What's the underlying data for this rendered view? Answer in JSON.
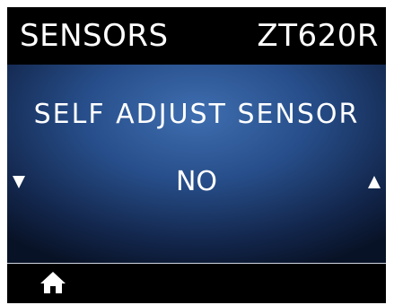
{
  "header": {
    "menu_title": "SENSORS",
    "printer_model": "ZT620R"
  },
  "setting": {
    "name": "SELF ADJUST SENSOR",
    "value": "NO"
  },
  "controls": {
    "prev_icon": "triangle-down-icon",
    "next_icon": "triangle-up-icon",
    "home_icon": "home-icon"
  },
  "colors": {
    "screen_center": "#3f6eb0",
    "screen_edge": "#081226",
    "text": "#ffffff",
    "bezel": "#000000"
  }
}
